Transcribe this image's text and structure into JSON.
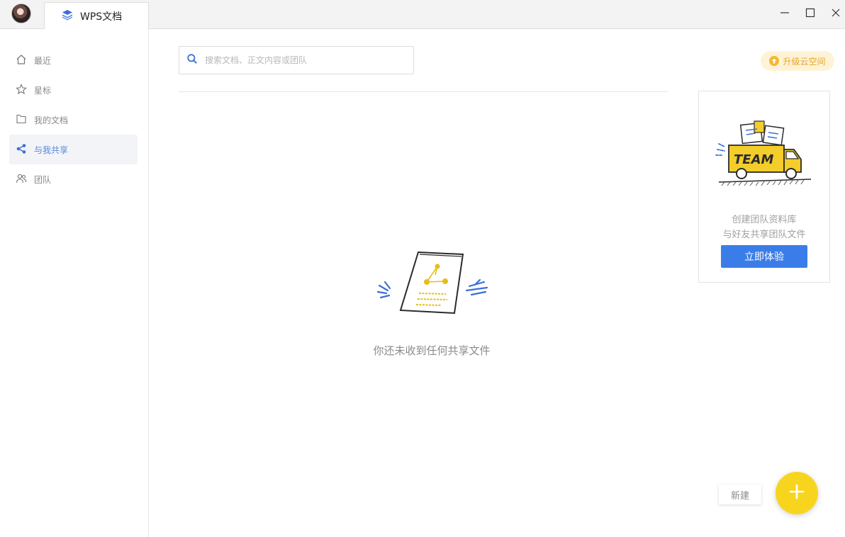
{
  "titlebar": {
    "tab_title": "WPS文档",
    "controls": [
      "minimize-icon",
      "maximize-icon",
      "close-icon"
    ]
  },
  "sidebar": {
    "items": [
      {
        "label": "最近",
        "icon": "home-icon",
        "active": false
      },
      {
        "label": "星标",
        "icon": "star-icon",
        "active": false
      },
      {
        "label": "我的文档",
        "icon": "folder-icon",
        "active": false
      },
      {
        "label": "与我共享",
        "icon": "share-icon",
        "active": true
      },
      {
        "label": "团队",
        "icon": "team-icon",
        "active": false
      }
    ]
  },
  "search": {
    "placeholder": "搜索文档、正文内容或团队",
    "value": ""
  },
  "upgrade": {
    "label": "升级云空间"
  },
  "empty_state": {
    "message": "你还未收到任何共享文件"
  },
  "team_card": {
    "illustration_text": "TEAM",
    "line1": "创建团队资料库",
    "line2": "与好友共享团队文件",
    "button_label": "立即体验"
  },
  "new_button": {
    "label": "新建"
  },
  "colors": {
    "accent_blue": "#3b7de8",
    "active_nav_text": "#5b86d6",
    "fab_yellow": "#f7d51f",
    "upgrade_text": "#e3a52a"
  }
}
